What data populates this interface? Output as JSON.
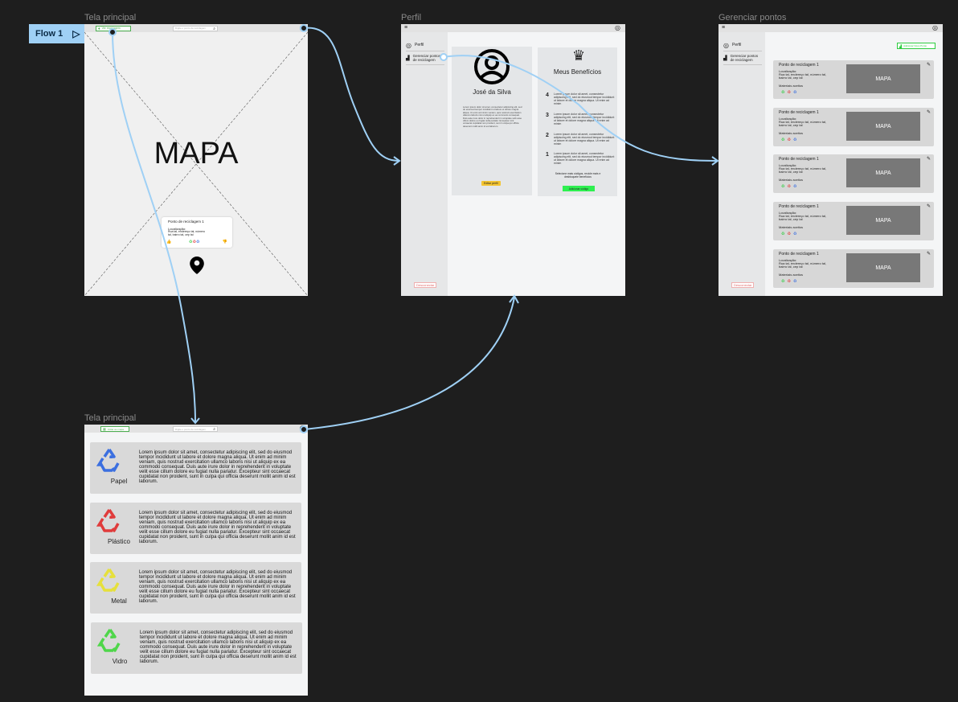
{
  "flow": {
    "label": "Flow 1"
  },
  "frames": {
    "main": {
      "label": "Tela principal"
    },
    "profile": {
      "label": "Perfil"
    },
    "manage": {
      "label": "Gerenciar pontos"
    },
    "main2": {
      "label": "Tela principal"
    }
  },
  "main": {
    "top_button": "Ver reciclagem",
    "search_placeholder": "Digite o ponto de reciclagem",
    "map_label": "MAPA",
    "popup": {
      "title": "Ponto de reciclagem 1",
      "loc_label": "Localização:",
      "loc_text": "Rua tal, endereço tal, número tal, bairro tal, cep tal"
    }
  },
  "profile": {
    "sidebar": {
      "item1": "Perfil",
      "item2": "Gerenciar pontos de reciclagem",
      "logout": "Desconectar"
    },
    "user": {
      "name": "José da Silva",
      "bio": "Lorem ipsum dolor sit amet, consectetur adipiscing elit, sed do eiusmod tempor incididunt ut labore et dolore magna aliqua. Ut enim ad minim veniam, quis nostrud exercitation ullamco laboris nisi ut aliquip ex ea commodo consequat. Duis aute irure dolor in reprehenderit in voluptate velit esse cillum dolore eu fugiat nulla pariatur. Excepteur sint occaecat cupidatat non proident, sunt in culpa qui officia deserunt mollit anim id est laborum.",
      "edit_button": "Editar perfil"
    },
    "benefits": {
      "title": "Meus Benefícios",
      "items": [
        {
          "num": "4",
          "text": "Lorem ipsum dolor sit amet, consectetur adipiscing elit, sed do eiusmod tempor incididunt ut labore et dolore magna aliqua. Ut enim ad minim"
        },
        {
          "num": "3",
          "text": "Lorem ipsum dolor sit amet, consectetur adipiscing elit, sed do eiusmod tempor incididunt ut labore et dolore magna aliqua. Ut enim ad minim"
        },
        {
          "num": "2",
          "text": "Lorem ipsum dolor sit amet, consectetur adipiscing elit, sed do eiusmod tempor incididunt ut labore et dolore magna aliqua. Ut enim ad minim"
        },
        {
          "num": "1",
          "text": "Lorem ipsum dolor sit amet, consectetur adipiscing elit, sed do eiusmod tempor incididunt ut labore et dolore magna aliqua. Ut enim ad minim"
        }
      ],
      "footer": "Selecione mais códigos, recicle mais e desbloqueie benefícios",
      "button": "Adicionar código"
    }
  },
  "manage": {
    "sidebar": {
      "item1": "Perfil",
      "item2": "Gerenciar pontos de reciclagem",
      "logout": "Desconectar"
    },
    "add_button": "Adicionar Novo Ponto",
    "points": [
      {
        "title": "Ponto de reciclagem 1",
        "loc_label": "Localização:",
        "loc": "Rua tal, endereço tal, número tal, bairro tal, cep tal",
        "materials": "Materiais aceitos",
        "map": "MAPA"
      },
      {
        "title": "Ponto de reciclagem 1",
        "loc_label": "Localização:",
        "loc": "Rua tal, endereço tal, número tal, bairro tal, cep tal",
        "materials": "Materiais aceitos",
        "map": "MAPA"
      },
      {
        "title": "Ponto de reciclagem 1",
        "loc_label": "Localização:",
        "loc": "Rua tal, endereço tal, número tal, bairro tal, cep tal",
        "materials": "Materiais aceitos",
        "map": "MAPA"
      },
      {
        "title": "Ponto de reciclagem 1",
        "loc_label": "Localização:",
        "loc": "Rua tal, endereço tal, número tal, bairro tal, cep tal",
        "materials": "Materiais aceitos",
        "map": "MAPA"
      },
      {
        "title": "Ponto de reciclagem 1",
        "loc_label": "Localização:",
        "loc": "Rua tal, endereço tal, número tal, bairro tal, cep tal",
        "materials": "Materiais aceitos",
        "map": "MAPA"
      }
    ]
  },
  "main2": {
    "top_button": "Voltar ao mapa",
    "search_placeholder": "Digite o ponto de reciclagem",
    "categories": [
      {
        "name": "Papel",
        "color": "#3b6fe0",
        "text": "Lorem ipsum dolor sit amet, consectetur adipiscing elit, sed do eiusmod tempor incididunt ut labore et dolore magna aliqua. Ut enim ad minim veniam, quis nostrud exercitation ullamco laboris nisi ut aliquip ex ea commodo consequat. Duis aute irure dolor in reprehenderit in voluptate velit esse cillum dolore eu fugiat nulla pariatur. Excepteur sint occaecat cupidatat non proident, sunt in culpa qui officia deserunt mollit anim id est laborum."
      },
      {
        "name": "Plástico",
        "color": "#e03b3b",
        "text": "Lorem ipsum dolor sit amet, consectetur adipiscing elit, sed do eiusmod tempor incididunt ut labore et dolore magna aliqua. Ut enim ad minim veniam, quis nostrud exercitation ullamco laboris nisi ut aliquip ex ea commodo consequat. Duis aute irure dolor in reprehenderit in voluptate velit esse cillum dolore eu fugiat nulla pariatur. Excepteur sint occaecat cupidatat non proident, sunt in culpa qui officia deserunt mollit anim id est laborum."
      },
      {
        "name": "Metal",
        "color": "#e6e03b",
        "text": "Lorem ipsum dolor sit amet, consectetur adipiscing elit, sed do eiusmod tempor incididunt ut labore et dolore magna aliqua. Ut enim ad minim veniam, quis nostrud exercitation ullamco laboris nisi ut aliquip ex ea commodo consequat. Duis aute irure dolor in reprehenderit in voluptate velit esse cillum dolore eu fugiat nulla pariatur. Excepteur sint occaecat cupidatat non proident, sunt in culpa qui officia deserunt mollit anim id est laborum."
      },
      {
        "name": "Vidro",
        "color": "#4fd64a",
        "text": "Lorem ipsum dolor sit amet, consectetur adipiscing elit, sed do eiusmod tempor incididunt ut labore et dolore magna aliqua. Ut enim ad minim veniam, quis nostrud exercitation ullamco laboris nisi ut aliquip ex ea commodo consequat. Duis aute irure dolor in reprehenderit in voluptate velit esse cillum dolore eu fugiat nulla pariatur. Excepteur sint occaecat cupidatat non proident, sunt in culpa qui officia deserunt mollit anim id est laborum."
      }
    ]
  },
  "colors": {
    "canvas": "#1e1e1e",
    "connector": "#9fd0f5",
    "accent_green": "#2ecc40",
    "accent_yellow": "#f4c430"
  }
}
